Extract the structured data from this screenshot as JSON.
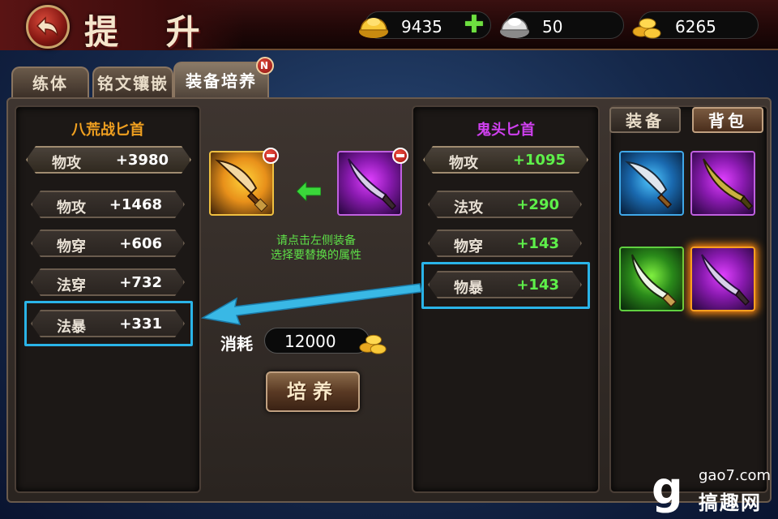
{
  "header": {
    "back_icon": "back-arrow-icon",
    "title": "提 升",
    "currencies": [
      {
        "name": "gold-ingot",
        "icon": "gold-ingot-icon",
        "value": "9435"
      },
      {
        "name": "silver-ingot",
        "icon": "silver-ingot-icon",
        "value": "50"
      },
      {
        "name": "gold-coins",
        "icon": "gold-coins-icon",
        "value": "6265"
      }
    ]
  },
  "tabs": [
    {
      "label": "练体"
    },
    {
      "label": "铭文镶嵌"
    },
    {
      "label": "装备培养",
      "badge": "N"
    }
  ],
  "left_panel": {
    "title": "八荒战匕首",
    "title_color": "#f0a020",
    "stats": [
      {
        "name": "物攻",
        "value": "+3980"
      },
      {
        "name": "物攻",
        "value": "+1468"
      },
      {
        "name": "物穿",
        "value": "+606"
      },
      {
        "name": "法穿",
        "value": "+732"
      },
      {
        "name": "法暴",
        "value": "+331"
      }
    ]
  },
  "center": {
    "hint_line1": "请点击左侧装备",
    "hint_line2": "选择要替换的属性",
    "cost_label": "消耗",
    "cost_value": "12000",
    "button_label": "培养"
  },
  "right_panel": {
    "title": "鬼头匕首",
    "title_color": "#d040f0",
    "stats": [
      {
        "name": "物攻",
        "value": "+1095"
      },
      {
        "name": "法攻",
        "value": "+290"
      },
      {
        "name": "物穿",
        "value": "+143"
      },
      {
        "name": "物暴",
        "value": "+143"
      }
    ]
  },
  "side_tabs": {
    "equip_label": "装备",
    "bag_label": "背包"
  },
  "watermark": {
    "logo": "g",
    "domain": "gao7.com",
    "name": "搞趣网"
  },
  "colors": {
    "highlight": "#2ab4e8",
    "positive_stat": "#5ef04a"
  }
}
